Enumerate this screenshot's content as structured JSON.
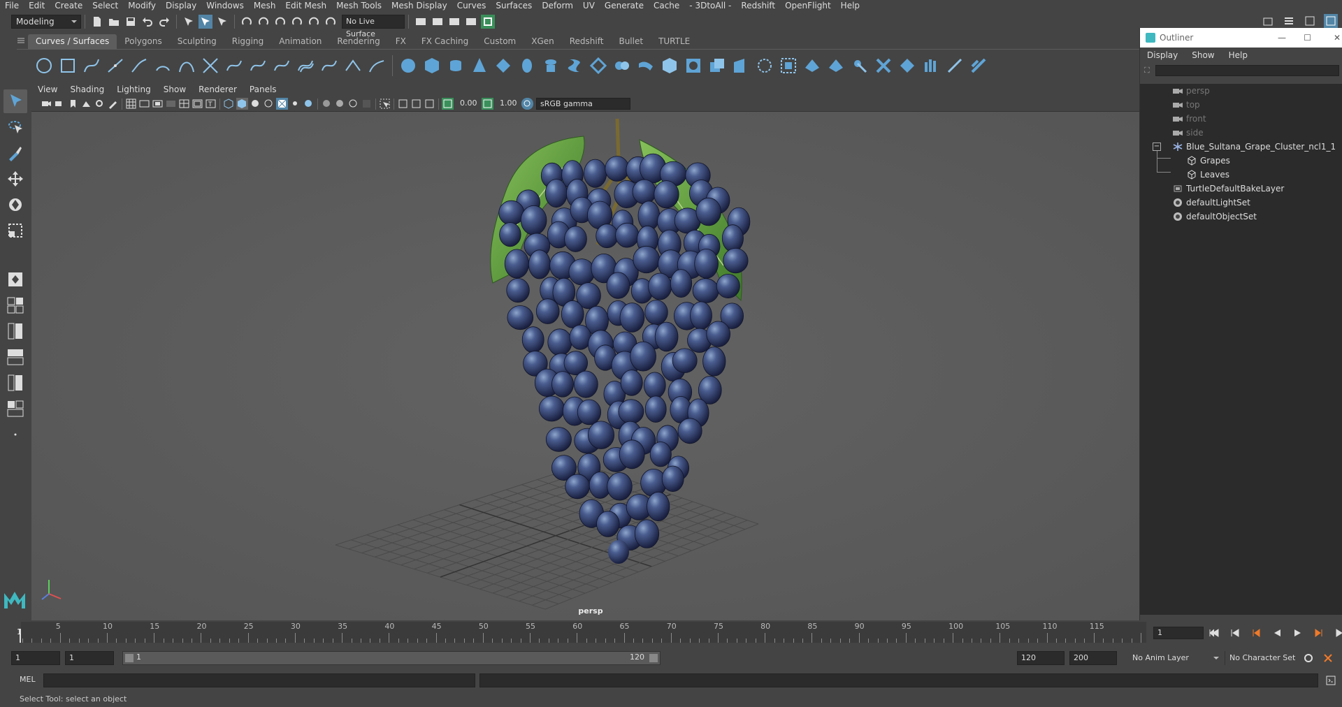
{
  "menubar": [
    "File",
    "Edit",
    "Create",
    "Select",
    "Modify",
    "Display",
    "Windows",
    "Mesh",
    "Edit Mesh",
    "Mesh Tools",
    "Mesh Display",
    "Curves",
    "Surfaces",
    "Deform",
    "UV",
    "Generate",
    "Cache",
    "- 3DtoAll -",
    "Redshift",
    "OpenFlight",
    "Help"
  ],
  "statusline": {
    "workspace": "Modeling",
    "live_surface": "No Live Surface"
  },
  "shelf_tabs": [
    "Curves / Surfaces",
    "Polygons",
    "Sculpting",
    "Rigging",
    "Animation",
    "Rendering",
    "FX",
    "FX Caching",
    "Custom",
    "XGen",
    "Redshift",
    "Bullet",
    "TURTLE"
  ],
  "viewport": {
    "menu": [
      "View",
      "Shading",
      "Lighting",
      "Show",
      "Renderer",
      "Panels"
    ],
    "exposure": "0.00",
    "gamma": "1.00",
    "color_space": "sRGB gamma",
    "camera_label": "persp"
  },
  "outliner": {
    "title": "Outliner",
    "menu": [
      "Display",
      "Show",
      "Help"
    ],
    "items": [
      {
        "label": "persp",
        "type": "camera",
        "dim": true
      },
      {
        "label": "top",
        "type": "camera",
        "dim": true
      },
      {
        "label": "front",
        "type": "camera",
        "dim": true
      },
      {
        "label": "side",
        "type": "camera",
        "dim": true
      },
      {
        "label": "Blue_Sultana_Grape_Cluster_ncl1_1",
        "type": "group",
        "dim": false
      },
      {
        "label": "Grapes",
        "type": "mesh",
        "dim": false
      },
      {
        "label": "Leaves",
        "type": "mesh",
        "dim": false
      },
      {
        "label": "TurtleDefaultBakeLayer",
        "type": "layer",
        "dim": false
      },
      {
        "label": "defaultLightSet",
        "type": "set",
        "dim": false
      },
      {
        "label": "defaultObjectSet",
        "type": "set",
        "dim": false
      }
    ]
  },
  "timeline": {
    "ticks": [
      "5",
      "10",
      "15",
      "20",
      "25",
      "30",
      "35",
      "40",
      "45",
      "50",
      "55",
      "60",
      "65",
      "70",
      "75",
      "80",
      "85",
      "90",
      "95",
      "100",
      "105",
      "110",
      "115"
    ],
    "start_marker": "1",
    "current_frame": "1"
  },
  "range": {
    "start": "1",
    "playback_start": "1",
    "slider_start": "1",
    "slider_end": "120",
    "playback_end": "120",
    "end": "200",
    "anim_layer": "No Anim Layer",
    "character_set": "No Character Set"
  },
  "cmdline": {
    "label": "MEL"
  },
  "helpline": "Select Tool: select an object",
  "colors": {
    "accent": "#5285a6",
    "grape": "#3b4a78",
    "leaf": "#5a9a3a",
    "bg_viewport": "#5c5c5c"
  }
}
